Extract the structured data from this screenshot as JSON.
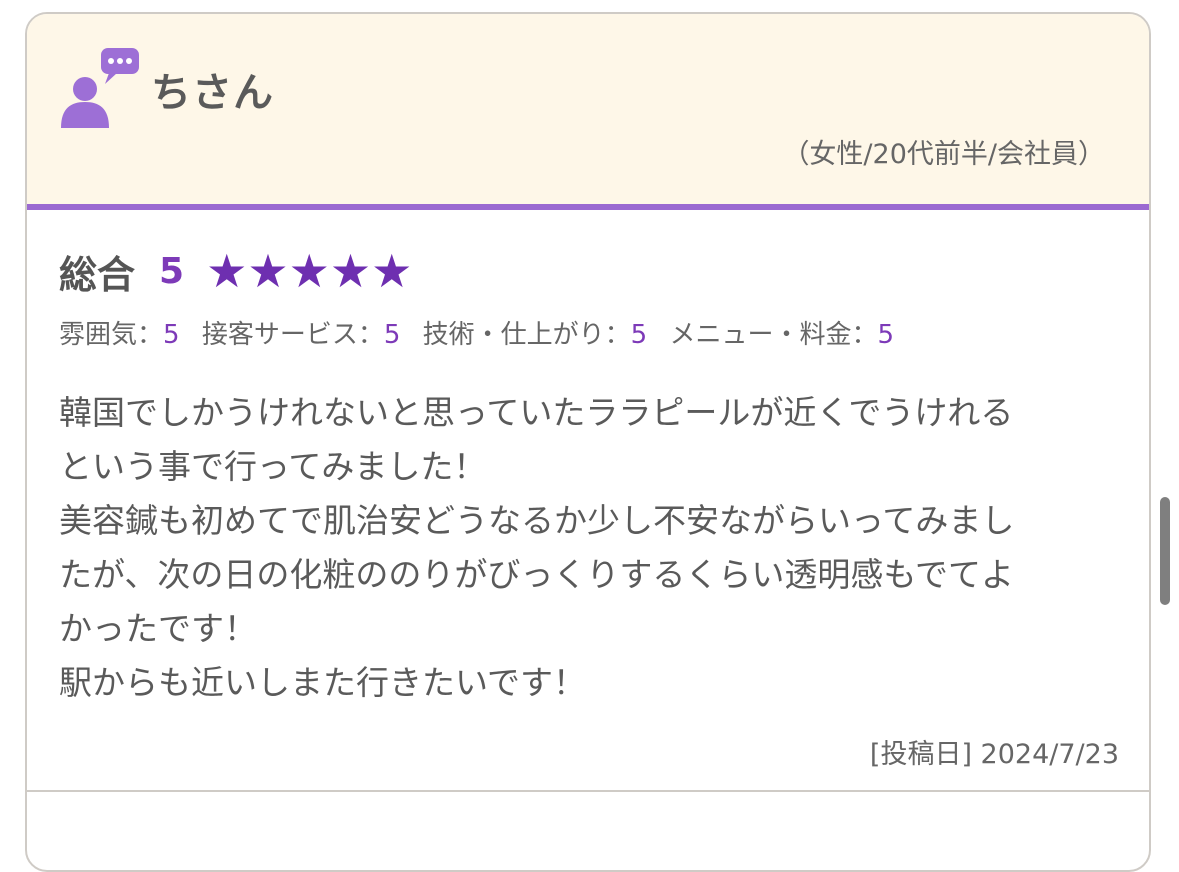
{
  "reviewer": {
    "name": "ちさん",
    "profile": "（女性/20代前半/会社員）",
    "icon": "user-comment-icon"
  },
  "rating": {
    "overall_label": "総合",
    "overall_score": "5",
    "stars": 5,
    "star_glyph": "★",
    "sub_ratings": [
      {
        "label": "雰囲気：",
        "value": "5"
      },
      {
        "label": "接客サービス：",
        "value": "5"
      },
      {
        "label": "技術・仕上がり：",
        "value": "5"
      },
      {
        "label": "メニュー・料金：",
        "value": "5"
      }
    ]
  },
  "review": {
    "lines": [
      "韓国でしかうけれないと思っていたララピールが近くでうけれる",
      "という事で行ってみました！",
      "美容鍼も初めてで肌治安どうなるか少し不安ながらいってみまし",
      "たが、次の日の化粧ののりがびっくりするくらい透明感もでてよ",
      "かったです！",
      "駅からも近いしまた行きたいです！"
    ],
    "post_date": "[投稿日] 2024/7/23"
  },
  "colors": {
    "accent": "#7d3ab8",
    "header_bg": "#fef7e8",
    "header_rule": "#9b6ad1"
  }
}
